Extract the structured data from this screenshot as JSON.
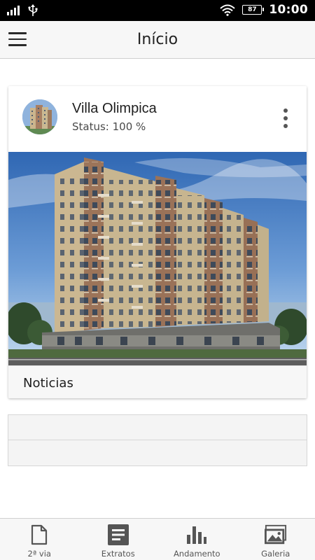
{
  "status_bar": {
    "battery": "87",
    "time": "10:00"
  },
  "app_bar": {
    "title": "Início",
    "menu_icon": "hamburger-menu-icon"
  },
  "project_card": {
    "title": "Villa Olimpica",
    "status": "Status: 100 %",
    "more_icon": "more-vert-icon",
    "footer_label": "Noticias"
  },
  "bottom_nav": [
    {
      "label": "2ª via",
      "icon": "document-icon"
    },
    {
      "label": "Extratos",
      "icon": "list-icon"
    },
    {
      "label": "Andamento",
      "icon": "bar-chart-icon"
    },
    {
      "label": "Galeria",
      "icon": "gallery-icon"
    }
  ],
  "colors": {
    "app_bar_bg": "#f7f7f7",
    "status_bar_bg": "#000000",
    "icon_gray": "#555555"
  }
}
